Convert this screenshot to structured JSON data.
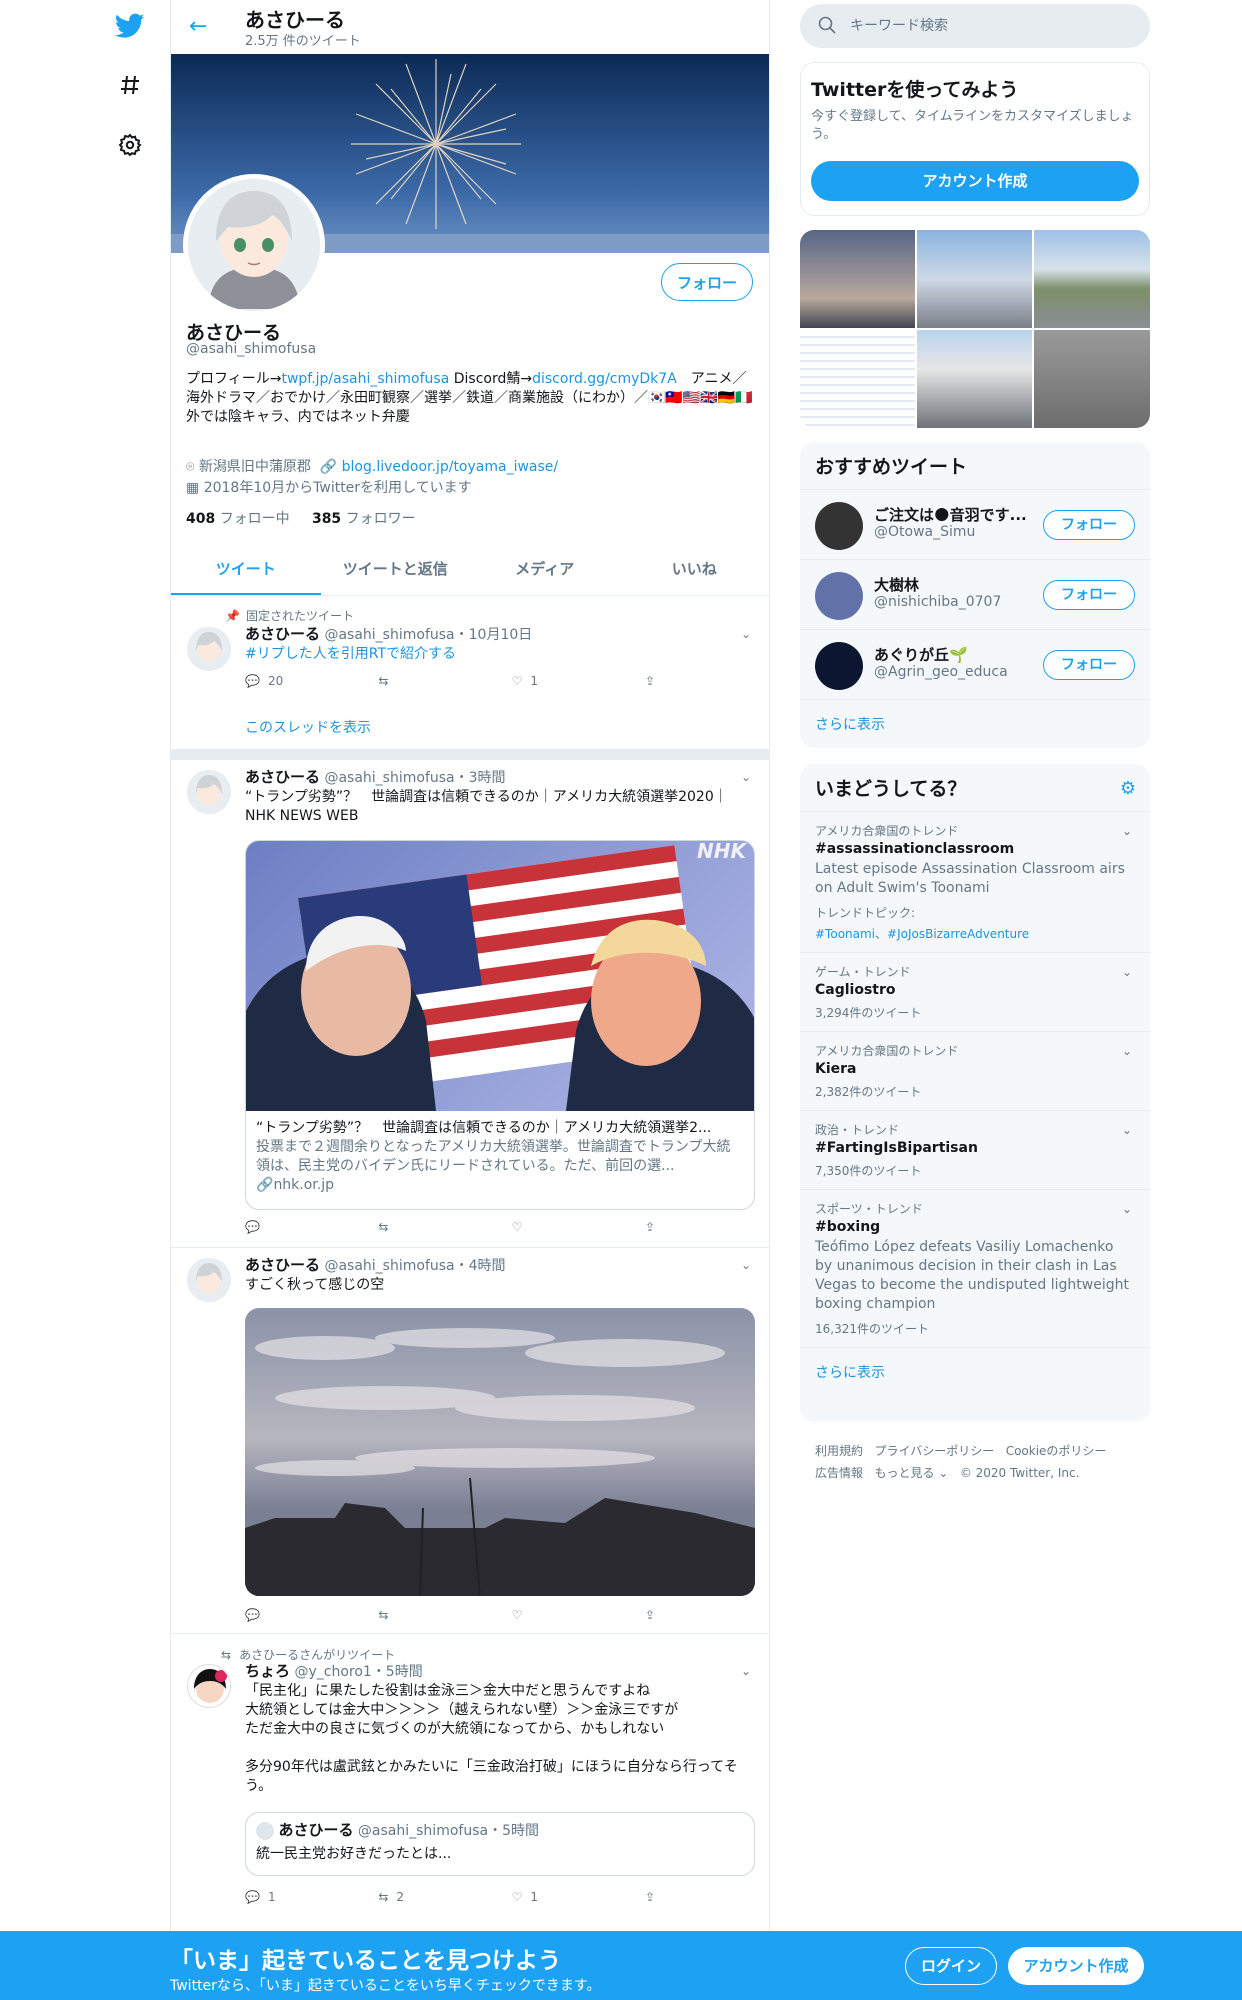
{
  "header": {
    "name": "あさひーる",
    "tweet_count": "2.5万 件のツイート"
  },
  "profile": {
    "name": "あさひーる",
    "handle": "@asahi_shimofusa",
    "follow": "フォロー",
    "bio_pre": "プロフィール→",
    "bio_link1": "twpf.jp/asahi_shimofusa",
    "bio_mid": " Discord鯖→",
    "bio_link2": "discord.gg/cmyDk7A",
    "bio_rest": "　アニメ／海外ドラマ／おでかけ／永田町観察／選挙／鉄道／商業施設（にわか）／🇰🇷🇹🇼🇺🇸🇬🇧🇩🇪🇮🇹",
    "bio_line2": "外では陰キャラ、内ではネット弁慶",
    "location": "新潟県旧中蒲原郡",
    "url": "blog.livedoor.jp/toyama_iwase/",
    "joined": "2018年10月からTwitterを利用しています",
    "following": "408",
    "following_label": "フォロー中",
    "followers": "385",
    "followers_label": "フォロワー"
  },
  "tabs": [
    "ツイート",
    "ツイートと返信",
    "メディア",
    "いいね"
  ],
  "tweets": [
    {
      "context": "固定されたツイート",
      "name": "あさひーる",
      "handle": "@asahi_shimofusa",
      "time": "・10月10日",
      "text": "#リプした人を引用RTで紹介する",
      "reply": "20",
      "rt": "",
      "like": "1",
      "thread": "このスレッドを表示"
    },
    {
      "name": "あさひーる",
      "handle": "@asahi_shimofusa",
      "time": "・3時間",
      "text": "“トランプ劣勢”？　世論調査は信頼できるのか｜アメリカ大統領選挙2020｜NHK NEWS WEB",
      "card_title": "“トランプ劣勢”？　世論調査は信頼できるのか｜アメリカ大統領選挙2...",
      "card_desc": "投票まで２週間余りとなったアメリカ大統領選挙。世論調査でトランプ大統領は、民主党のバイデン氏にリードされている。ただ、前回の選...",
      "card_domain": "nhk.or.jp",
      "logo": "NHK"
    },
    {
      "name": "あさひーる",
      "handle": "@asahi_shimofusa",
      "time": "・4時間",
      "text": "すごく秋って感じの空"
    },
    {
      "context": "あさひーるさんがリツイート",
      "name": "ちょろ",
      "handle": "@y_choro1",
      "time": "・5時間",
      "text1": "「民主化」に果たした役割は金泳三＞金大中だと思うんですよね",
      "text2": "大統領としては金大中＞＞＞＞（越えられない壁）＞＞金泳三ですが",
      "text3": "ただ金大中の良さに気づくのが大統領になってから、かもしれない",
      "text4": "多分90年代は盧武鉉とかみたいに「三金政治打破」にほうに自分なら行ってそう。",
      "q_name": "あさひーる",
      "q_handle": "@asahi_shimofusa",
      "q_time": "・5時間",
      "q_text": "統一民主党お好きだったとは...",
      "reply": "1",
      "rt": "2",
      "like": "1"
    }
  ],
  "sidebar": {
    "search_placeholder": "キーワード検索",
    "signup": {
      "title": "Twitterを使ってみよう",
      "desc": "今すぐ登録して、タイムラインをカスタマイズしましょう。",
      "button": "アカウント作成"
    },
    "rec": {
      "title": "おすすめツイート",
      "items": [
        {
          "name": "ご注文は🌑音羽です...",
          "handle": "@Otowa_Simu",
          "follow": "フォロー"
        },
        {
          "name": "大樹林",
          "handle": "@nishichiba_0707",
          "follow": "フォロー"
        },
        {
          "name": "あぐりが丘🌱",
          "handle": "@Agrin_geo_educa",
          "follow": "フォロー"
        }
      ],
      "more": "さらに表示"
    },
    "trends": {
      "title": "いまどうしてる？",
      "items": [
        {
          "cat": "アメリカ合衆国のトレンド",
          "name": "#assassinationclassroom",
          "desc": "Latest episode Assassination Classroom airs on Adult Swim's Toonami",
          "topic_label": "トレンドトピック:",
          "topic_a": "#Toonami",
          "topic_sep": "、",
          "topic_b": "#JoJosBizarreAdventure"
        },
        {
          "cat": "ゲーム・トレンド",
          "name": "Cagliostro",
          "count": "3,294件のツイート"
        },
        {
          "cat": "アメリカ合衆国のトレンド",
          "name": "Kiera",
          "count": "2,382件のツイート"
        },
        {
          "cat": "政治・トレンド",
          "name": "#FartingIsBipartisan",
          "count": "7,350件のツイート"
        },
        {
          "cat": "スポーツ・トレンド",
          "name": "#boxing",
          "desc": "Teófimo López defeats Vasiliy Lomachenko by unanimous decision in their clash in Las Vegas to become the undisputed lightweight boxing champion",
          "count": "16,321件のツイート"
        }
      ],
      "more": "さらに表示"
    },
    "footer": {
      "terms": "利用規約",
      "privacy": "プライバシーポリシー",
      "cookie": "Cookieのポリシー",
      "ads": "広告情報",
      "more": "もっと見る",
      "copyright": "© 2020 Twitter, Inc."
    }
  },
  "bottombar": {
    "title": "「いま」起きていることを見つけよう",
    "sub": "Twitterなら、「いま」起きていることをいち早くチェックできます。",
    "login": "ログイン",
    "signup": "アカウント作成"
  },
  "colors": {
    "accent": "#1da1f2",
    "link": "#1b95e0"
  }
}
